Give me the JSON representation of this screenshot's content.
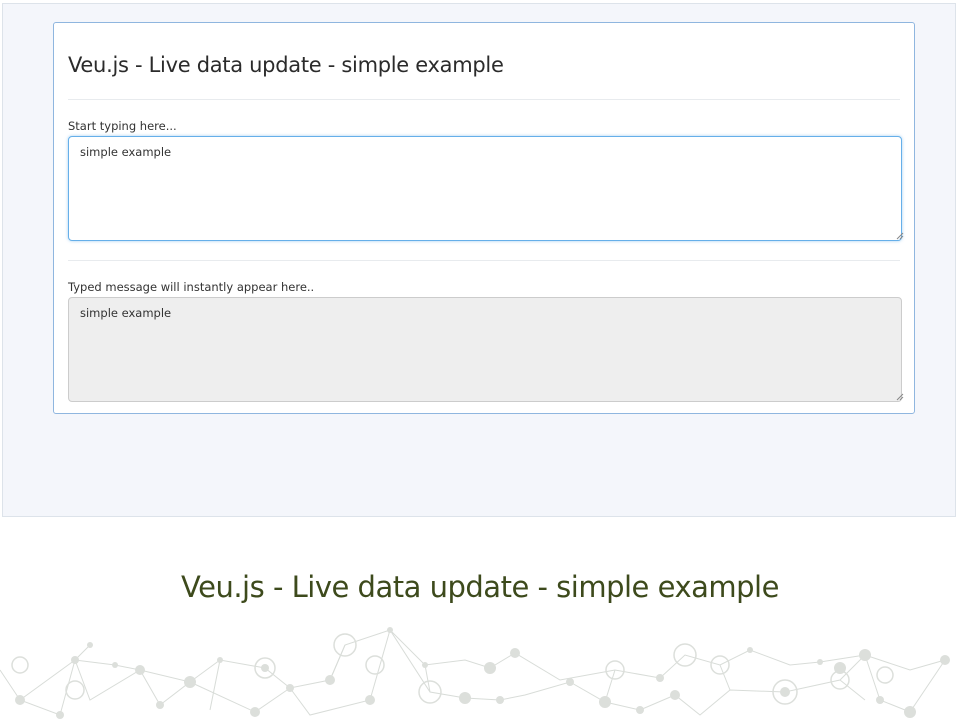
{
  "demo": {
    "title": "Veu.js - Live data update - simple example",
    "input_label": "Start typing here...",
    "input_value": "simple example",
    "output_label": "Typed message will instantly appear here..",
    "output_value": "simple example"
  },
  "page": {
    "heading": "Veu.js - Live data update - simple example"
  },
  "colors": {
    "heading": "#3d4a1c",
    "panel_border": "#8fb6df",
    "focus_border": "#66afe9",
    "readonly_bg": "#eeeeee"
  }
}
